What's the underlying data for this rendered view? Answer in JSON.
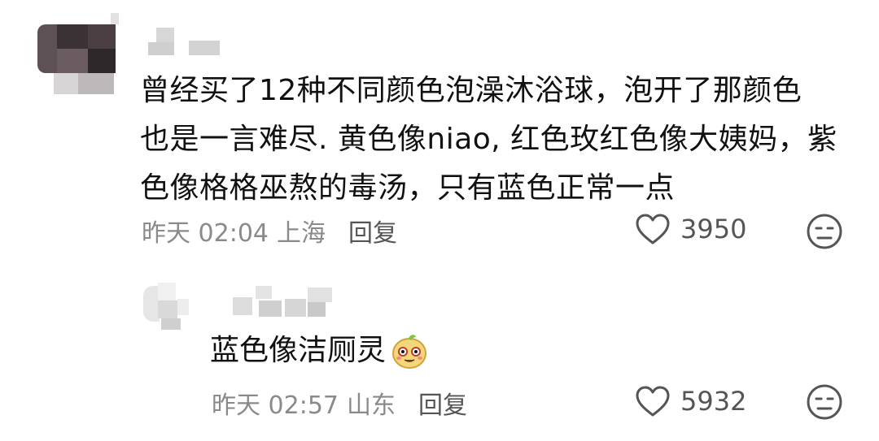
{
  "comment": {
    "text": "曾经买了12种不同颜色泡澡沐浴球，泡开了那颜色\n也是一言难尽. 黄色像niao, 红色玫红色像大姨妈，紫\n色像格格巫熬的毒汤，只有蓝色正常一点",
    "time": "昨天 02:04",
    "location": "上海",
    "reply_label": "回复",
    "likes": "3950",
    "dislike_icon": "meh-face-icon"
  },
  "reply": {
    "text": "蓝色像洁厕灵",
    "emoji": "sweat-smile-emoji",
    "time": "昨天 02:57",
    "location": "山东",
    "reply_label": "回复",
    "likes": "5932",
    "dislike_icon": "meh-face-icon"
  },
  "colors": {
    "text": "#111111",
    "meta": "#8a8a8a",
    "icon": "#555555"
  }
}
